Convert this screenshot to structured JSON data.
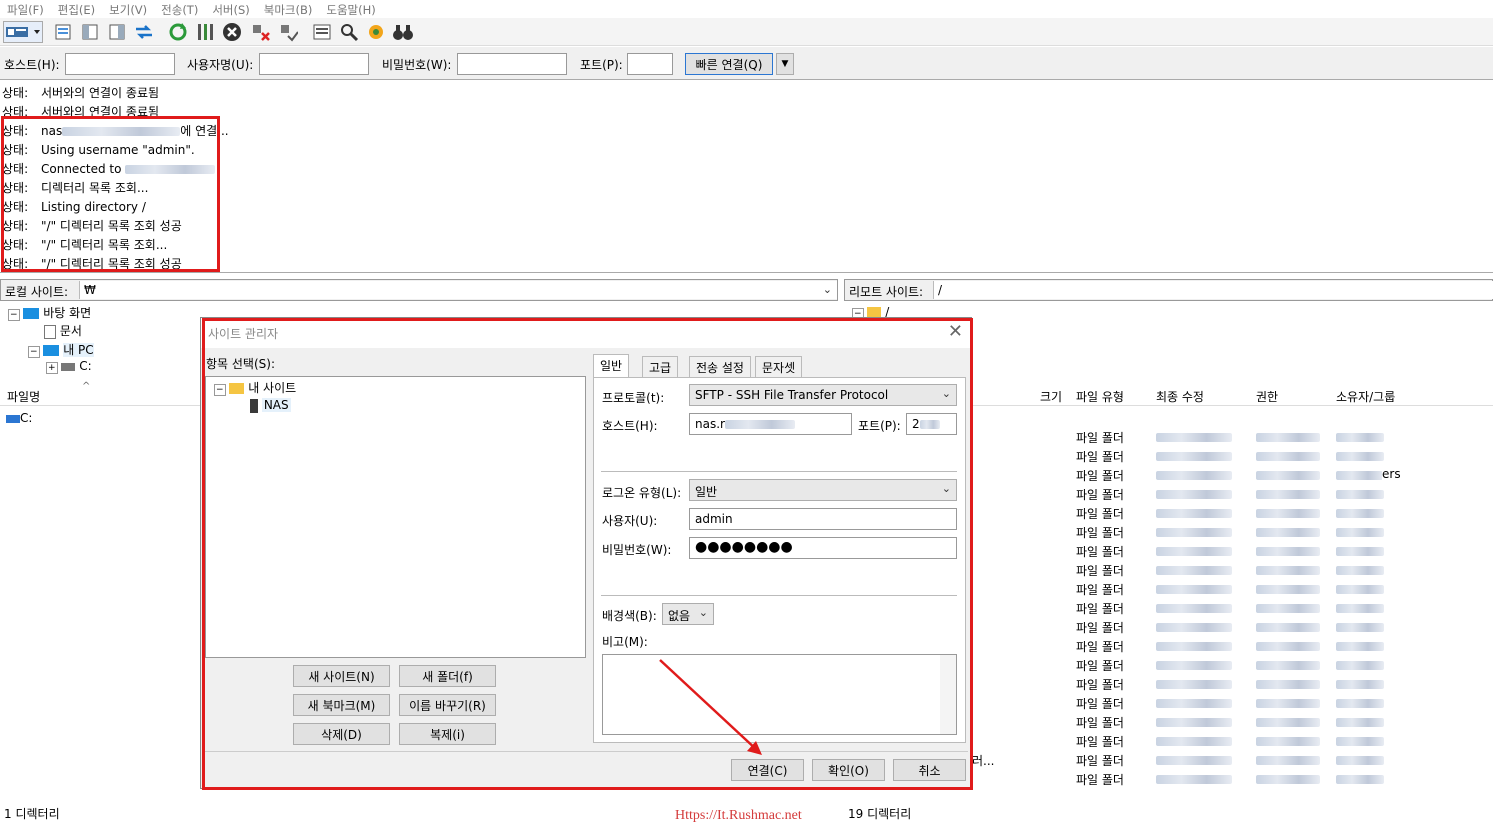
{
  "menu": [
    "파일(F)",
    "편집(E)",
    "보기(V)",
    "전송(T)",
    "서버(S)",
    "북마크(B)",
    "도움말(H)"
  ],
  "quick": {
    "host_label": "호스트(H):",
    "user_label": "사용자명(U):",
    "pass_label": "비밀번호(W):",
    "port_label": "포트(P):",
    "connect": "빠른 연결(Q)"
  },
  "log": [
    {
      "k": "상태:",
      "v": "서버와의 연결이 종료됨"
    },
    {
      "k": "상태:",
      "v": "서버와의 연결이 종료됨"
    },
    {
      "k": "상태:",
      "v": "nas",
      "tail": "에 연결..."
    },
    {
      "k": "상태:",
      "v": "Using username \"admin\"."
    },
    {
      "k": "상태:",
      "v": "Connected to"
    },
    {
      "k": "상태:",
      "v": "디렉터리 목록 조회..."
    },
    {
      "k": "상태:",
      "v": "Listing directory /"
    },
    {
      "k": "상태:",
      "v": "\"/\" 디렉터리 목록 조회 성공"
    },
    {
      "k": "상태:",
      "v": "\"/\" 디렉터리 목록 조회..."
    },
    {
      "k": "상태:",
      "v": "\"/\" 디렉터리 목록 조회 성공"
    }
  ],
  "local": {
    "label": "로컬 사이트:",
    "path": "₩",
    "tree": [
      "바탕 화면",
      "문서",
      "내 PC",
      "C:"
    ],
    "col_name": "파일명",
    "drive": "C:",
    "status": "1 디렉터리"
  },
  "remote": {
    "label": "리모트 사이트:",
    "path": "/",
    "tree_root": "/",
    "cols": [
      "크기",
      "파일 유형",
      "최종 수정",
      "권한",
      "소유자/그룹"
    ],
    "row_type": "파일 폴더",
    "status": "19 디렉터리",
    "owner_fragment": "ers",
    "name_fragment": "러..."
  },
  "dialog": {
    "title": "사이트 관리자",
    "entry_label": "항목 선택(S):",
    "tree_root": "내 사이트",
    "tree_child": "NAS",
    "tabs": [
      "일반",
      "고급",
      "전송 설정",
      "문자셋"
    ],
    "protocol_label": "프로토콜(t):",
    "protocol": "SFTP - SSH File Transfer Protocol",
    "host_label": "호스트(H):",
    "host": "nas.r",
    "port_label": "포트(P):",
    "port": "2",
    "logon_label": "로그온 유형(L):",
    "logon": "일반",
    "user_label": "사용자(U):",
    "user": "admin",
    "pass_label": "비밀번호(W):",
    "pass": "●●●●●●●●",
    "bg_label": "배경색(B):",
    "bg": "없음",
    "memo_label": "비고(M):",
    "btn_new_site": "새 사이트(N)",
    "btn_new_folder": "새 폴더(f)",
    "btn_new_bookmark": "새 북마크(M)",
    "btn_rename": "이름 바꾸기(R)",
    "btn_delete": "삭제(D)",
    "btn_copy": "복제(i)",
    "btn_connect": "연결(C)",
    "btn_ok": "확인(O)",
    "btn_cancel": "취소"
  },
  "watermark": "Https://It.Rushmac.net",
  "colors": {
    "accent": "#e01b1b",
    "watermark": "#d43b3b"
  }
}
